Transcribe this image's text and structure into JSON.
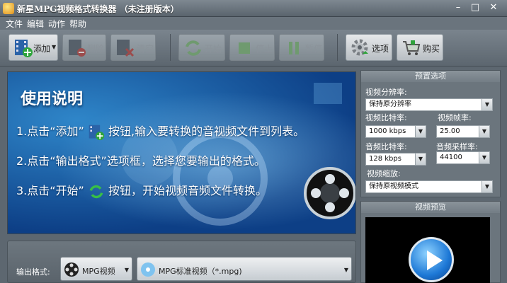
{
  "window": {
    "title": "新星MPG视频格式转换器 （未注册版本）",
    "minimize": "–",
    "maximize": "□",
    "close": "✕"
  },
  "menu": [
    "文件",
    "编辑",
    "动作",
    "帮助"
  ],
  "toolbar": {
    "add": "添加",
    "delete": "删除",
    "clear": "清空",
    "start": "开始",
    "stop": "停止",
    "pause": "暂停",
    "options": "选项",
    "buy": "购买"
  },
  "banner": {
    "heading": "使用说明",
    "step1_pre": "1.点击“添加”",
    "step1_post": "按钮,输入要转换的音视频文件到列表。",
    "step2": "2.点击“输出格式”选项框，选择您要输出的格式。",
    "step3_pre": "3.点击“开始”",
    "step3_post": "按钮，开始视频音频文件转换。"
  },
  "output": {
    "label": "输出格式:",
    "category": "MPG视频",
    "format": "MPG标准视频（*.mpg)"
  },
  "settings": {
    "header": "预置选项",
    "resolution_label": "视频分辨率:",
    "resolution_value": "保持原分辨率",
    "vbitrate_label": "视频比特率:",
    "vbitrate_value": "1000 kbps",
    "framerate_label": "视频帧率:",
    "framerate_value": "25.00",
    "abitrate_label": "音频比特率:",
    "abitrate_value": "128 kbps",
    "samplerate_label": "音频采样率:",
    "samplerate_value": "44100",
    "scale_label": "视频缩放:",
    "scale_value": "保持原视频模式"
  },
  "preview": {
    "header": "视频预览"
  }
}
